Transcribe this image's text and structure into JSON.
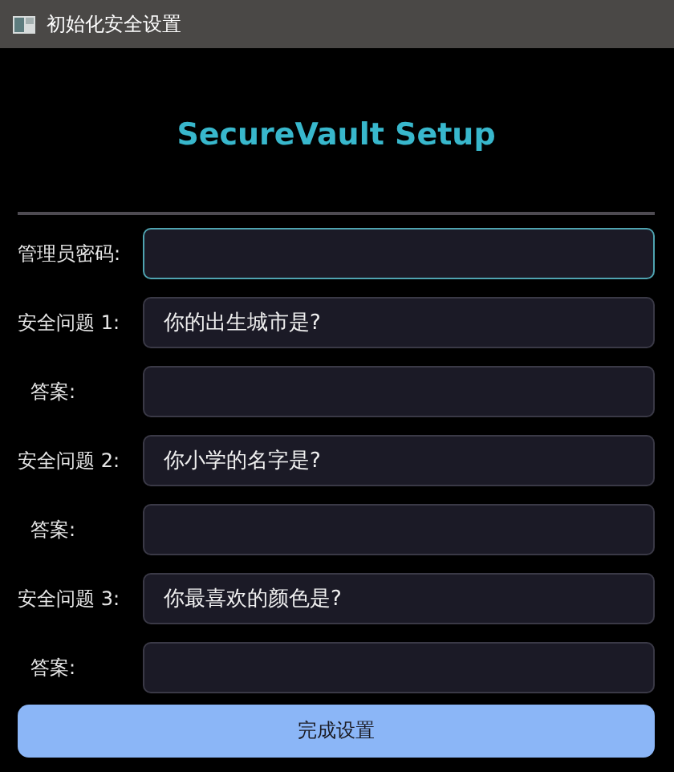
{
  "window": {
    "title": "初始化安全设置"
  },
  "heading": "SecureVault Setup",
  "fields": [
    {
      "kind": "password",
      "label": "管理员密码:",
      "focused": true
    },
    {
      "kind": "question",
      "label": "安全问题 1:",
      "value": "你的出生城市是?",
      "focused": false
    },
    {
      "kind": "answer",
      "label": "答案:",
      "focused": false
    },
    {
      "kind": "question",
      "label": "安全问题 2:",
      "value": "你小学的名字是?",
      "focused": false
    },
    {
      "kind": "answer",
      "label": "答案:",
      "focused": false
    },
    {
      "kind": "question",
      "label": "安全问题 3:",
      "value": "你最喜欢的颜色是?",
      "focused": false
    },
    {
      "kind": "answer",
      "label": "答案:",
      "focused": false
    }
  ],
  "button": "完成设置"
}
